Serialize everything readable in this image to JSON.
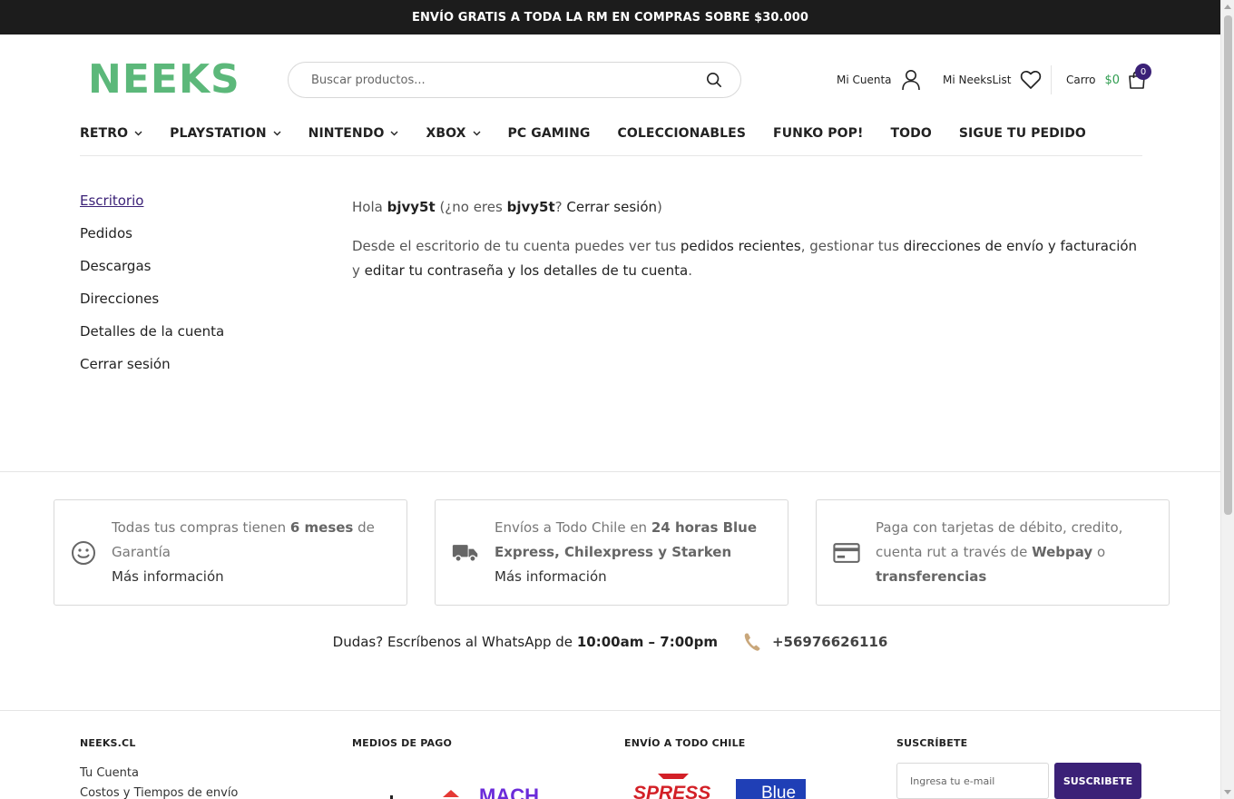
{
  "topbar": {
    "text": "ENVÍO GRATIS A TODA LA RM EN COMPRAS SOBRE $30.000"
  },
  "header": {
    "logo": "NEEKS",
    "search_placeholder": "Buscar productos...",
    "account_label": "Mi Cuenta",
    "wishlist_label": "Mi NeeksList",
    "cart_label": "Carro",
    "cart_total": "$0",
    "cart_count": "0"
  },
  "nav": [
    {
      "label": "RETRO",
      "dropdown": true
    },
    {
      "label": "PLAYSTATION",
      "dropdown": true
    },
    {
      "label": "NINTENDO",
      "dropdown": true
    },
    {
      "label": "XBOX",
      "dropdown": true
    },
    {
      "label": "PC GAMING",
      "dropdown": false
    },
    {
      "label": "COLECCIONABLES",
      "dropdown": false
    },
    {
      "label": "FUNKO POP!",
      "dropdown": false
    },
    {
      "label": "TODO",
      "dropdown": false
    },
    {
      "label": "SIGUE TU PEDIDO",
      "dropdown": false
    }
  ],
  "account_menu": [
    "Escritorio",
    "Pedidos",
    "Descargas",
    "Direcciones",
    "Detalles de la cuenta",
    "Cerrar sesión"
  ],
  "dashboard": {
    "hello": "Hola",
    "username": "bjvy5t",
    "not_you_open": "(¿no eres",
    "not_you_user": "bjvy5t",
    "not_you_q": "?",
    "logout": "Cerrar sesión",
    "close_paren": ")",
    "intro_1": "Desde el escritorio de tu cuenta puedes ver tus",
    "link_orders": "pedidos recientes",
    "intro_2": ", gestionar tus",
    "link_addresses": "direcciones de envío y facturación",
    "intro_3": "y",
    "link_account": "editar tu contraseña y los detalles de tu cuenta",
    "intro_end": "."
  },
  "features": [
    {
      "icon": "smiley-icon",
      "pre": "Todas tus compras tienen",
      "bold": "6 meses",
      "post": "de Garantía",
      "more": "Más información"
    },
    {
      "icon": "truck-icon",
      "pre": "Envíos a Todo Chile en",
      "bold": "24 horas Blue Express, Chilexpress y Starken",
      "post": "",
      "more": "Más información"
    },
    {
      "icon": "credit-card-icon",
      "pre": "Paga con tarjetas de débito, credito, cuenta rut a través de",
      "bold": "Webpay",
      "post": "o",
      "bold2": "transferencias",
      "more": ""
    }
  ],
  "whatsapp": {
    "text": "Dudas? Escríbenos al WhatsApp de",
    "hours": "10:00am – 7:00pm",
    "phone": "+56976626116"
  },
  "footer": {
    "col1_title": "NEEKS.CL",
    "col1_links": [
      "Tu Cuenta",
      "Costos y Tiempos de envío"
    ],
    "col2_title": "MEDIOS DE PAGO",
    "col3_title": "ENVÍO A TODO CHILE",
    "col4_title": "SUSCRÍBETE",
    "newsletter_placeholder": "Ingresa tu e-mail",
    "newsletter_button": "SUSCRIBETE",
    "pay_logo_text": "MACH",
    "ship_logo_1": "SPRESS",
    "ship_logo_2": "Blue"
  },
  "colors": {
    "brand": "#5cb87a",
    "accent": "#3b2177",
    "topbar": "#1c1c1c",
    "price": "#2e9c4f"
  }
}
